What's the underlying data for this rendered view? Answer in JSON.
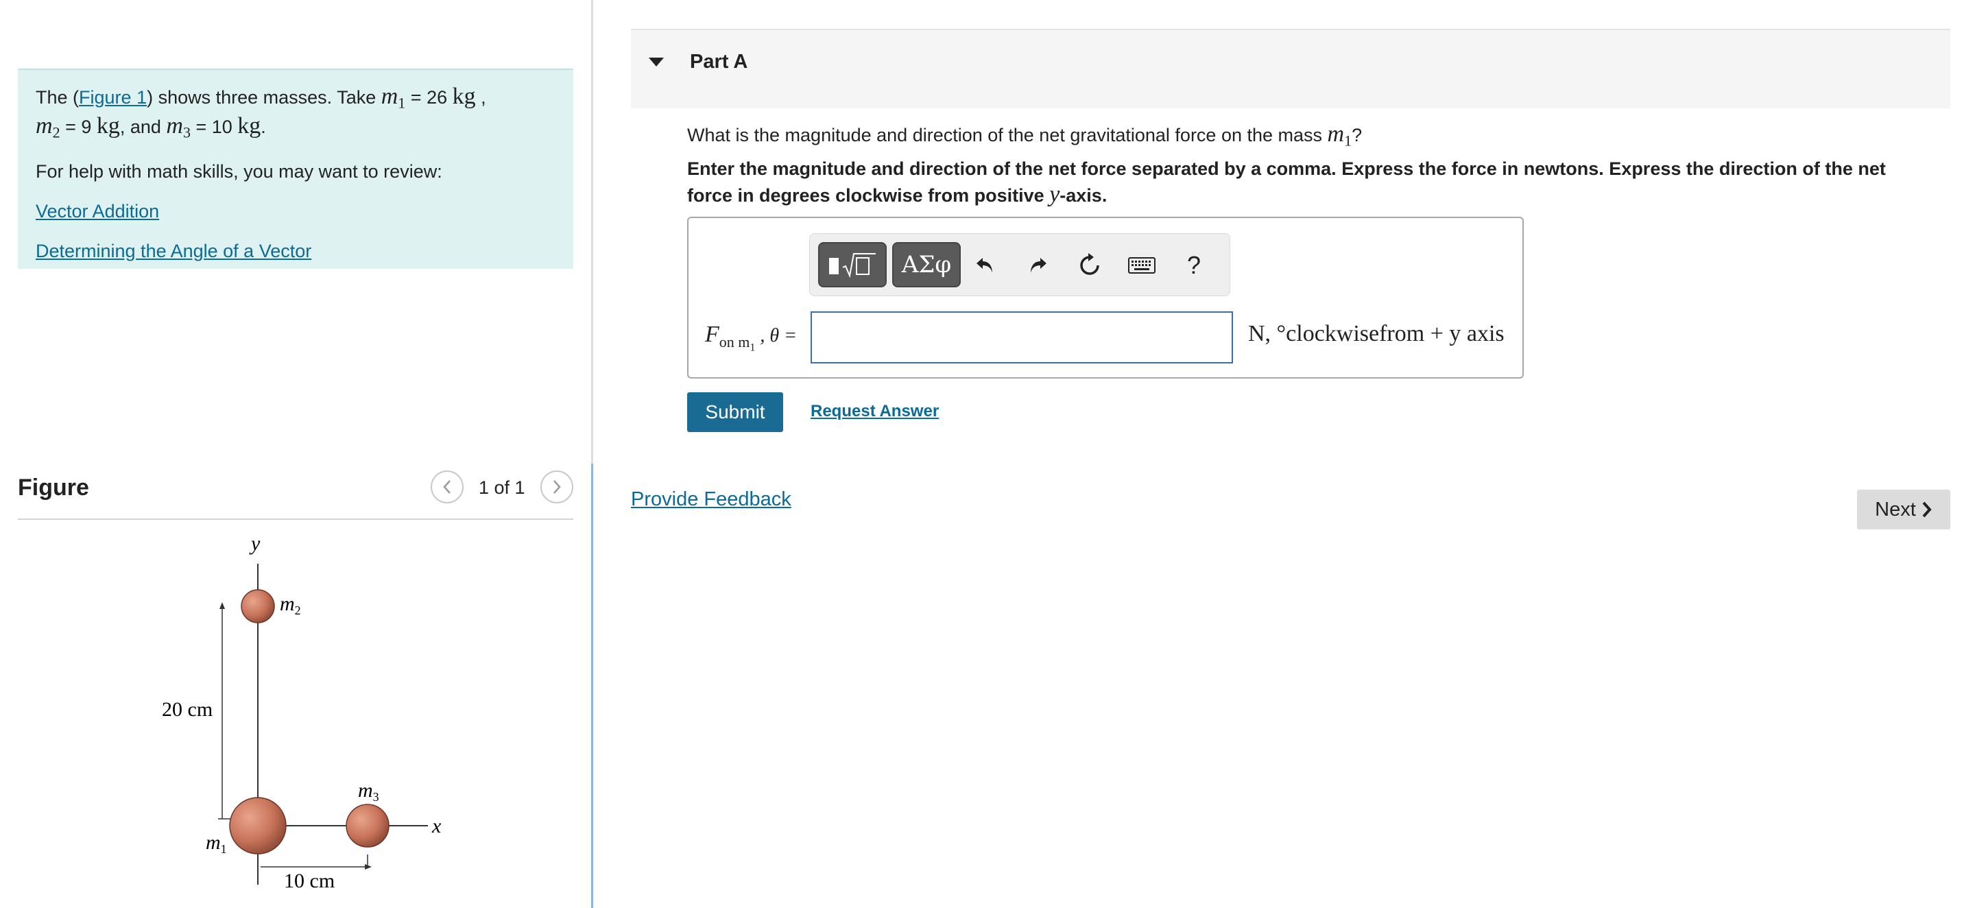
{
  "intro": {
    "text_before_link": "The (",
    "figure_link": "Figure 1",
    "text_after_link": ") shows three masses. Take ",
    "m1_symbol": "m",
    "m1_sub": "1",
    "m1_value": " = 26 ",
    "kg_unit": "kg",
    "comma": " ,",
    "m2_symbol": "m",
    "m2_sub": "2",
    "m2_value": " = 9 ",
    "kg2_unit": "kg",
    "and_text": ", and ",
    "m3_symbol": "m",
    "m3_sub": "3",
    "m3_value": " = 10 ",
    "kg3_unit": "kg",
    "period": ".",
    "help_text": "For help with math skills, you may want to review:",
    "link_vector_addition": "Vector Addition",
    "link_angle": "Determining the Angle of a Vector"
  },
  "figure": {
    "title": "Figure",
    "counter": "1 of 1",
    "label_y": "y",
    "label_x": "x",
    "label_m1": "m",
    "label_m1_sub": "1",
    "label_m2": "m",
    "label_m2_sub": "2",
    "label_m3": "m",
    "label_m3_sub": "3",
    "dim_vertical": "20 cm",
    "dim_horizontal": "10 cm"
  },
  "part": {
    "title": "Part A",
    "question_text": "What is the magnitude and direction of the net gravitational force on the mass ",
    "question_sym": "m",
    "question_sub": "1",
    "question_end": "?",
    "instructions_a": "Enter the magnitude and direction of the net force separated by a comma. Express the force in newtons. Express the direction of the net force in degrees clockwise from positive ",
    "instructions_sym": "y",
    "instructions_b": "-axis."
  },
  "toolbar": {
    "symbols_label": "ΑΣφ",
    "help_label": "?"
  },
  "answer": {
    "label_F": "F",
    "label_sub": "on m",
    "label_sub2": "1",
    "label_rest": " , θ = ",
    "value": "",
    "units": "N,  °clockwisefrom + y axis"
  },
  "actions": {
    "submit": "Submit",
    "request_answer": "Request Answer",
    "provide_feedback": "Provide Feedback",
    "next": "Next"
  },
  "colors": {
    "intro_bg": "#def2f1",
    "link": "#0b6a96",
    "submit_bg": "#1a6b93",
    "sphere": "#c8745a"
  }
}
